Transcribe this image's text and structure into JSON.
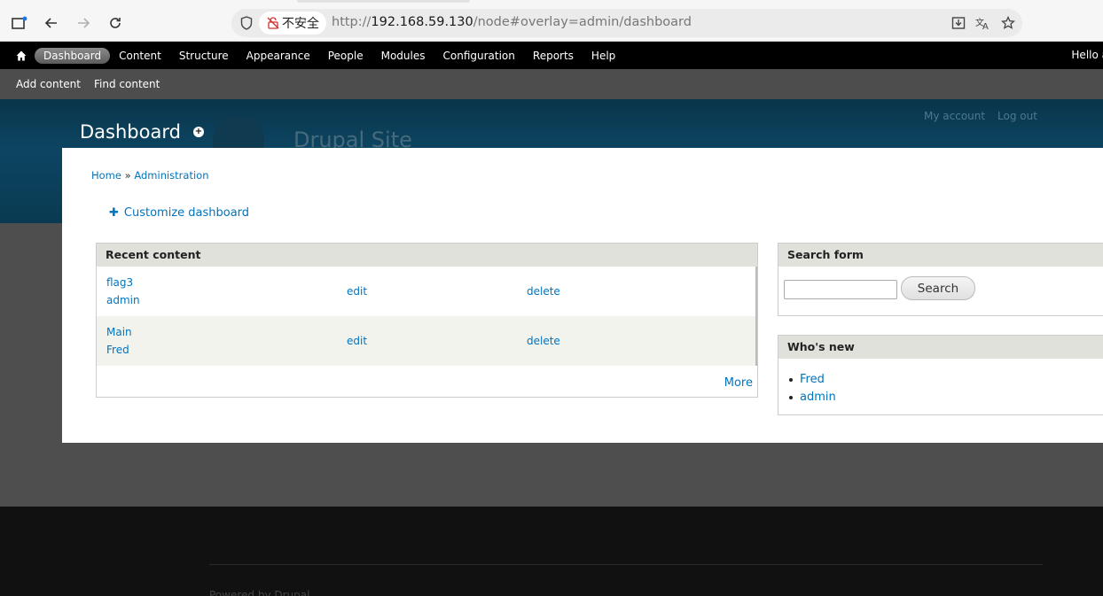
{
  "browser": {
    "security_label": "不安全",
    "url_scheme": "http://",
    "url_host": "192.168.59.130",
    "url_path": "/node#overlay=admin/dashboard"
  },
  "toolbar": {
    "items": [
      "Dashboard",
      "Content",
      "Structure",
      "Appearance",
      "People",
      "Modules",
      "Configuration",
      "Reports",
      "Help"
    ],
    "active": "Dashboard",
    "greeting": "Hello a"
  },
  "shortcuts": [
    "Add content",
    "Find content"
  ],
  "site": {
    "my_account": "My account",
    "logout": "Log out",
    "name": "Drupal Site",
    "powered_by": "Powered by Drupal"
  },
  "overlay": {
    "title": "Dashboard",
    "breadcrumb_home": "Home",
    "breadcrumb_sep": "»",
    "breadcrumb_admin": "Administration",
    "customize": "Customize dashboard"
  },
  "recent_content": {
    "heading": "Recent content",
    "rows": [
      {
        "title": "flag3",
        "author": "admin",
        "edit": "edit",
        "delete": "delete"
      },
      {
        "title": "Main",
        "author": "Fred",
        "edit": "edit",
        "delete": "delete"
      }
    ],
    "more": "More"
  },
  "search_form": {
    "heading": "Search form",
    "button": "Search"
  },
  "whos_new": {
    "heading": "Who's new",
    "users": [
      "Fred",
      "admin"
    ]
  }
}
